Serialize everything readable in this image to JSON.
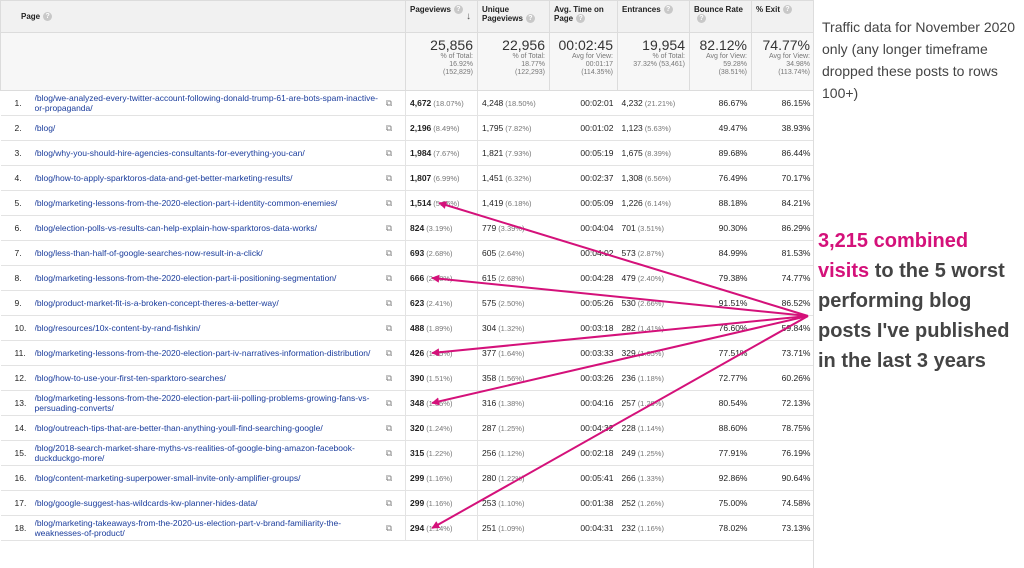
{
  "columns": {
    "page": "Page",
    "pageviews": "Pageviews",
    "unique": "Unique Pageviews",
    "avg_time": "Avg. Time on Page",
    "entrances": "Entrances",
    "bounce": "Bounce Rate",
    "exit": "% Exit"
  },
  "totals": {
    "pageviews": {
      "big": "25,856",
      "sub1": "% of Total:",
      "sub2": "16.92%",
      "sub3": "(152,829)"
    },
    "unique": {
      "big": "22,956",
      "sub1": "% of Total:",
      "sub2": "18.77%",
      "sub3": "(122,293)"
    },
    "avg_time": {
      "big": "00:02:45",
      "sub1": "Avg for View:",
      "sub2": "00:01:17",
      "sub3": "(114.35%)"
    },
    "entrances": {
      "big": "19,954",
      "sub1": "% of Total:",
      "sub2": "37.32% (53,461)",
      "sub3": ""
    },
    "bounce": {
      "big": "82.12%",
      "sub1": "Avg for View:",
      "sub2": "59.28%",
      "sub3": "(38.51%)"
    },
    "exit": {
      "big": "74.77%",
      "sub1": "Avg for View:",
      "sub2": "34.98%",
      "sub3": "(113.74%)"
    }
  },
  "rows": [
    {
      "n": "1.",
      "path": "/blog/we-analyzed-every-twitter-account-following-donald-trump-61-are-bots-spam-inactive-or-propaganda/",
      "pv": "4,672",
      "pv_pct": "(18.07%)",
      "up": "4,248",
      "up_pct": "(18.50%)",
      "time": "00:02:01",
      "ent": "4,232",
      "ent_pct": "(21.21%)",
      "bounce": "86.67%",
      "exit": "86.15%"
    },
    {
      "n": "2.",
      "path": "/blog/",
      "pv": "2,196",
      "pv_pct": "(8.49%)",
      "up": "1,795",
      "up_pct": "(7.82%)",
      "time": "00:01:02",
      "ent": "1,123",
      "ent_pct": "(5.63%)",
      "bounce": "49.47%",
      "exit": "38.93%"
    },
    {
      "n": "3.",
      "path": "/blog/why-you-should-hire-agencies-consultants-for-everything-you-can/",
      "pv": "1,984",
      "pv_pct": "(7.67%)",
      "up": "1,821",
      "up_pct": "(7.93%)",
      "time": "00:05:19",
      "ent": "1,675",
      "ent_pct": "(8.39%)",
      "bounce": "89.68%",
      "exit": "86.44%"
    },
    {
      "n": "4.",
      "path": "/blog/how-to-apply-sparktoros-data-and-get-better-marketing-results/",
      "pv": "1,807",
      "pv_pct": "(6.99%)",
      "up": "1,451",
      "up_pct": "(6.32%)",
      "time": "00:02:37",
      "ent": "1,308",
      "ent_pct": "(6.56%)",
      "bounce": "76.49%",
      "exit": "70.17%"
    },
    {
      "n": "5.",
      "path": "/blog/marketing-lessons-from-the-2020-election-part-i-identity-common-enemies/",
      "pv": "1,514",
      "pv_pct": "(5.86%)",
      "up": "1,419",
      "up_pct": "(6.18%)",
      "time": "00:05:09",
      "ent": "1,226",
      "ent_pct": "(6.14%)",
      "bounce": "88.18%",
      "exit": "84.21%"
    },
    {
      "n": "6.",
      "path": "/blog/election-polls-vs-results-can-help-explain-how-sparktoros-data-works/",
      "pv": "824",
      "pv_pct": "(3.19%)",
      "up": "779",
      "up_pct": "(3.39%)",
      "time": "00:04:04",
      "ent": "701",
      "ent_pct": "(3.51%)",
      "bounce": "90.30%",
      "exit": "86.29%"
    },
    {
      "n": "7.",
      "path": "/blog/less-than-half-of-google-searches-now-result-in-a-click/",
      "pv": "693",
      "pv_pct": "(2.68%)",
      "up": "605",
      "up_pct": "(2.64%)",
      "time": "00:04:02",
      "ent": "573",
      "ent_pct": "(2.87%)",
      "bounce": "84.99%",
      "exit": "81.53%"
    },
    {
      "n": "8.",
      "path": "/blog/marketing-lessons-from-the-2020-election-part-ii-positioning-segmentation/",
      "pv": "666",
      "pv_pct": "(2.58%)",
      "up": "615",
      "up_pct": "(2.68%)",
      "time": "00:04:28",
      "ent": "479",
      "ent_pct": "(2.40%)",
      "bounce": "79.38%",
      "exit": "74.77%"
    },
    {
      "n": "9.",
      "path": "/blog/product-market-fit-is-a-broken-concept-theres-a-better-way/",
      "pv": "623",
      "pv_pct": "(2.41%)",
      "up": "575",
      "up_pct": "(2.50%)",
      "time": "00:05:26",
      "ent": "530",
      "ent_pct": "(2.66%)",
      "bounce": "91.51%",
      "exit": "86.52%"
    },
    {
      "n": "10.",
      "path": "/blog/resources/10x-content-by-rand-fishkin/",
      "pv": "488",
      "pv_pct": "(1.89%)",
      "up": "304",
      "up_pct": "(1.32%)",
      "time": "00:03:18",
      "ent": "282",
      "ent_pct": "(1.41%)",
      "bounce": "76.60%",
      "exit": "59.84%"
    },
    {
      "n": "11.",
      "path": "/blog/marketing-lessons-from-the-2020-election-part-iv-narratives-information-distribution/",
      "pv": "426",
      "pv_pct": "(1.65%)",
      "up": "377",
      "up_pct": "(1.64%)",
      "time": "00:03:33",
      "ent": "329",
      "ent_pct": "(1.65%)",
      "bounce": "77.51%",
      "exit": "73.71%"
    },
    {
      "n": "12.",
      "path": "/blog/how-to-use-your-first-ten-sparktoro-searches/",
      "pv": "390",
      "pv_pct": "(1.51%)",
      "up": "358",
      "up_pct": "(1.56%)",
      "time": "00:03:26",
      "ent": "236",
      "ent_pct": "(1.18%)",
      "bounce": "72.77%",
      "exit": "60.26%"
    },
    {
      "n": "13.",
      "path": "/blog/marketing-lessons-from-the-2020-election-part-iii-polling-problems-growing-fans-vs-persuading-converts/",
      "pv": "348",
      "pv_pct": "(1.35%)",
      "up": "316",
      "up_pct": "(1.38%)",
      "time": "00:04:16",
      "ent": "257",
      "ent_pct": "(1.29%)",
      "bounce": "80.54%",
      "exit": "72.13%"
    },
    {
      "n": "14.",
      "path": "/blog/outreach-tips-that-are-better-than-anything-youll-find-searching-google/",
      "pv": "320",
      "pv_pct": "(1.24%)",
      "up": "287",
      "up_pct": "(1.25%)",
      "time": "00:04:32",
      "ent": "228",
      "ent_pct": "(1.14%)",
      "bounce": "88.60%",
      "exit": "78.75%"
    },
    {
      "n": "15.",
      "path": "/blog/2018-search-market-share-myths-vs-realities-of-google-bing-amazon-facebook-duckduckgo-more/",
      "pv": "315",
      "pv_pct": "(1.22%)",
      "up": "256",
      "up_pct": "(1.12%)",
      "time": "00:02:18",
      "ent": "249",
      "ent_pct": "(1.25%)",
      "bounce": "77.91%",
      "exit": "76.19%"
    },
    {
      "n": "16.",
      "path": "/blog/content-marketing-superpower-small-invite-only-amplifier-groups/",
      "pv": "299",
      "pv_pct": "(1.16%)",
      "up": "280",
      "up_pct": "(1.22%)",
      "time": "00:05:41",
      "ent": "266",
      "ent_pct": "(1.33%)",
      "bounce": "92.86%",
      "exit": "90.64%"
    },
    {
      "n": "17.",
      "path": "/blog/google-suggest-has-wildcards-kw-planner-hides-data/",
      "pv": "299",
      "pv_pct": "(1.16%)",
      "up": "253",
      "up_pct": "(1.10%)",
      "time": "00:01:38",
      "ent": "252",
      "ent_pct": "(1.26%)",
      "bounce": "75.00%",
      "exit": "74.58%"
    },
    {
      "n": "18.",
      "path": "/blog/marketing-takeaways-from-the-2020-us-election-part-v-brand-familiarity-the-weaknesses-of-product/",
      "pv": "294",
      "pv_pct": "(1.14%)",
      "up": "251",
      "up_pct": "(1.09%)",
      "time": "00:04:31",
      "ent": "232",
      "ent_pct": "(1.16%)",
      "bounce": "78.02%",
      "exit": "73.13%"
    }
  ],
  "annotation": {
    "note": "Traffic data for November 2020 only (any longer timeframe dropped these posts to rows 100+)",
    "callout_highlight": "3,215 combined visits",
    "callout_rest": " to the 5 worst performing blog posts I've published in the last 3 years",
    "accent_color": "#d4117a"
  },
  "icons": {
    "help": "question-circle-icon",
    "sort": "arrow-down-icon",
    "open_link": "open-in-new-icon"
  }
}
